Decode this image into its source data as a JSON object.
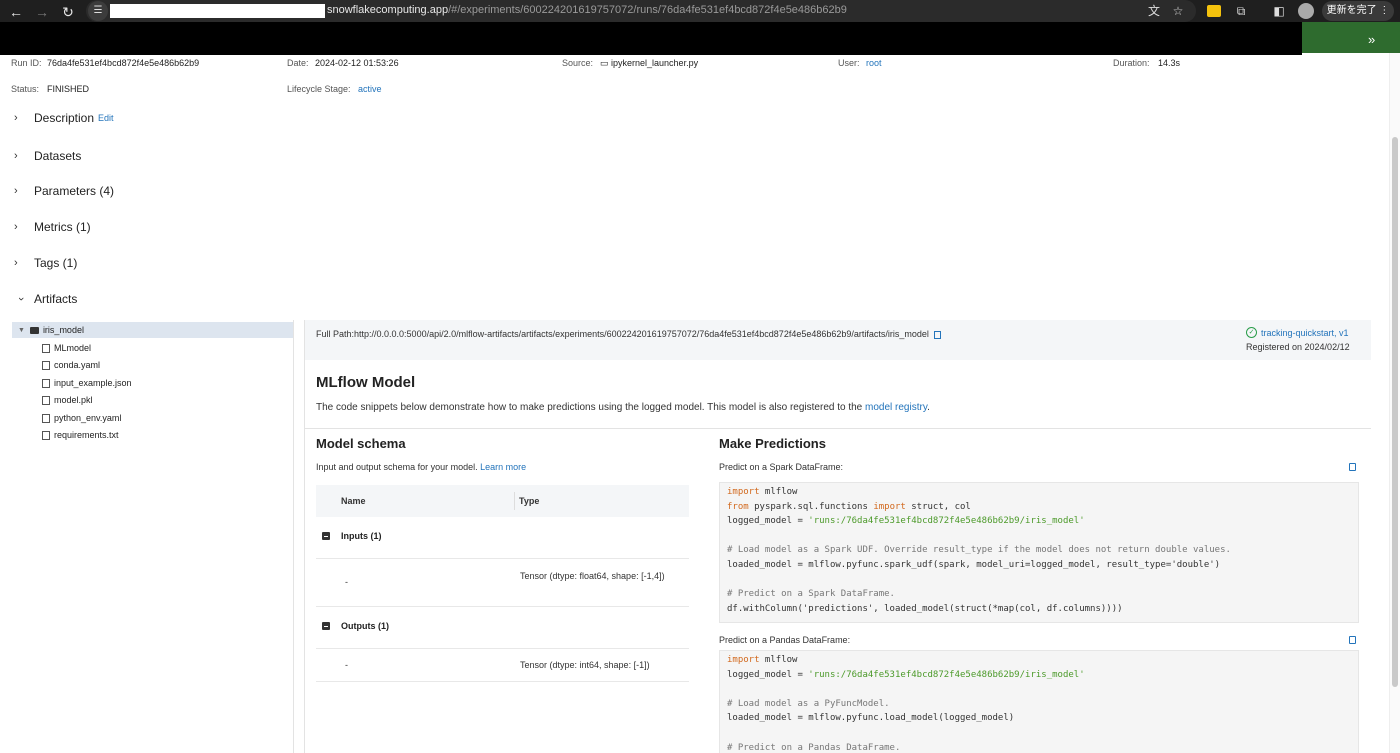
{
  "browser": {
    "url_host": "snowflakecomputing.app",
    "url_path": "/#/experiments/600224201619757072/runs/76da4fe531ef4bcd872f4e5e486b62b9",
    "update_button": "更新を完了",
    "more_label": "»"
  },
  "run": {
    "run_id_label": "Run ID:",
    "run_id": "76da4fe531ef4bcd872f4e5e486b62b9",
    "date_label": "Date:",
    "date": "2024-02-12 01:53:26",
    "source_label": "Source:",
    "source": "ipykernel_launcher.py",
    "user_label": "User:",
    "user": "root",
    "duration_label": "Duration:",
    "duration": "14.3s",
    "status_label": "Status:",
    "status": "FINISHED",
    "lifecycle_label": "Lifecycle Stage:",
    "lifecycle": "active"
  },
  "sections": {
    "description": "Description",
    "edit": "Edit",
    "datasets": "Datasets",
    "parameters": "Parameters (4)",
    "metrics": "Metrics (1)",
    "tags": "Tags (1)",
    "artifacts": "Artifacts"
  },
  "tree": {
    "root": "iris_model",
    "files": [
      "MLmodel",
      "conda.yaml",
      "input_example.json",
      "model.pkl",
      "python_env.yaml",
      "requirements.txt"
    ]
  },
  "artifact": {
    "full_path": "Full Path:http://0.0.0.0:5000/api/2.0/mlflow-artifacts/artifacts/experiments/600224201619757072/76da4fe531ef4bcd872f4e5e486b62b9/artifacts/iris_model",
    "registered_link": "tracking-quickstart, v1",
    "registered_date": "Registered on 2024/02/12",
    "title": "MLflow Model",
    "desc_text": "The code snippets below demonstrate how to make predictions using the logged model. This model is also registered to the ",
    "desc_link": "model registry",
    "desc_end": "."
  },
  "schema": {
    "title": "Model schema",
    "desc": "Input and output schema for your model. ",
    "learn_more": "Learn more",
    "col_name": "Name",
    "col_type": "Type",
    "inputs_label": "Inputs (1)",
    "input_name": "-",
    "input_type": "Tensor (dtype: float64, shape: [-1,4])",
    "outputs_label": "Outputs (1)",
    "output_name": "-",
    "output_type": "Tensor (dtype: int64, shape: [-1])"
  },
  "predictions": {
    "title": "Make Predictions",
    "spark_label": "Predict on a Spark DataFrame:",
    "pandas_label": "Predict on a Pandas DataFrame:",
    "spark_code": {
      "l1_kw": "import",
      "l1": " mlflow",
      "l2_kw": "from",
      "l2a": " pyspark.sql.functions ",
      "l2_kw2": "import",
      "l2b": " struct, col",
      "l3": "logged_model = ",
      "l3_str": "'runs:/76da4fe531ef4bcd872f4e5e486b62b9/iris_model'",
      "l5": "# Load model as a Spark UDF. Override result_type if the model does not return double values.",
      "l6": "loaded_model = mlflow.pyfunc.spark_udf(spark, model_uri=logged_model, result_type='double')",
      "l8": "# Predict on a Spark DataFrame.",
      "l9": "df.withColumn('predictions', loaded_model(struct(*map(col, df.columns))))"
    },
    "pandas_code": {
      "l1_kw": "import",
      "l1": " mlflow",
      "l2": "logged_model = ",
      "l2_str": "'runs:/76da4fe531ef4bcd872f4e5e486b62b9/iris_model'",
      "l4": "# Load model as a PyFuncModel.",
      "l5": "loaded_model = mlflow.pyfunc.load_model(logged_model)",
      "l7": "# Predict on a Pandas DataFrame."
    }
  }
}
